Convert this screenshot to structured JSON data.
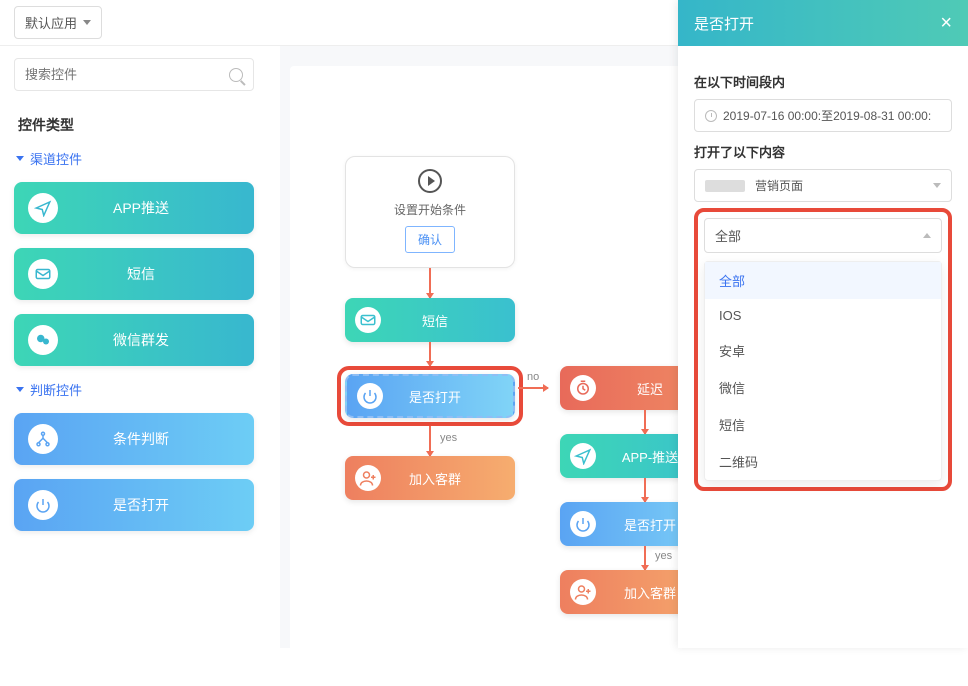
{
  "header": {
    "app_select": "默认应用"
  },
  "sidebar": {
    "search_placeholder": "搜索控件",
    "section_title": "控件类型",
    "groups": [
      {
        "key": "channel",
        "label": "渠道控件"
      },
      {
        "key": "condition",
        "label": "判断控件"
      }
    ],
    "channel_widgets": [
      {
        "key": "app_push",
        "label": "APP推送",
        "icon": "send"
      },
      {
        "key": "sms",
        "label": "短信",
        "icon": "mail"
      },
      {
        "key": "wechat_mass",
        "label": "微信群发",
        "icon": "wechat"
      }
    ],
    "condition_widgets": [
      {
        "key": "condition",
        "label": "条件判断",
        "icon": "branch"
      },
      {
        "key": "is_open",
        "label": "是否打开",
        "icon": "power"
      }
    ]
  },
  "canvas": {
    "start": {
      "title": "设置开始条件",
      "confirm": "确认"
    },
    "nodes": {
      "sms": "短信",
      "is_open": "是否打开",
      "join_group": "加入客群",
      "delay": "延迟",
      "app_push": "APP-推送",
      "is_open2": "是否打开",
      "join_group2": "加入客群"
    },
    "edges": {
      "yes": "yes",
      "no": "no"
    }
  },
  "panel": {
    "title": "是否打开",
    "fields": {
      "time_label": "在以下时间段内",
      "time_value": "2019-07-16 00:00:至2019-08-31 00:00:",
      "content_label": "打开了以下内容",
      "content_value": "营销页面",
      "channel_label": "全部"
    },
    "dropdown": {
      "selected": "全部",
      "options": [
        "全部",
        "IOS",
        "安卓",
        "微信",
        "短信",
        "二维码"
      ]
    }
  }
}
